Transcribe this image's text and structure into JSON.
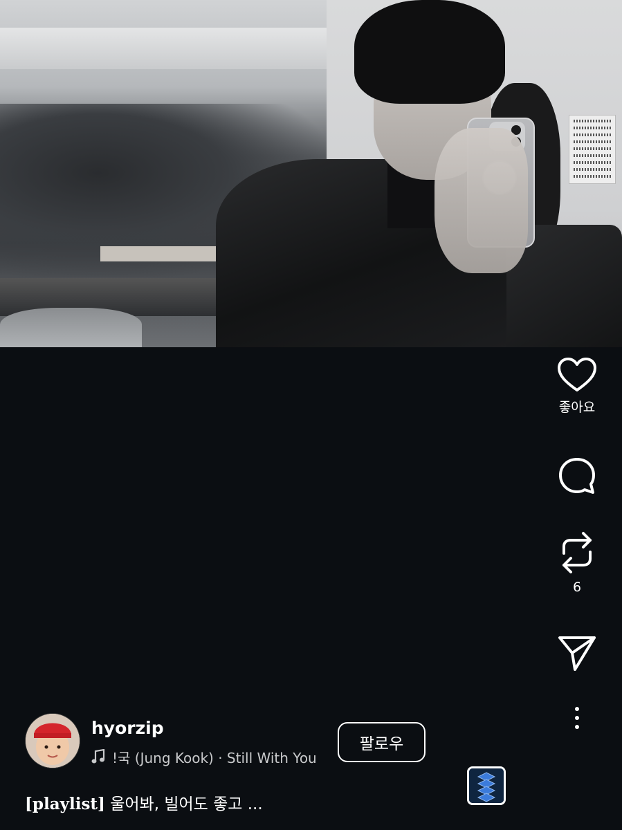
{
  "post": {
    "like_label": "좋아요",
    "repost_count": "6",
    "username": "hyorzip",
    "music": "!국 (Jung Kook) · Still With You",
    "follow_label": "팔로우",
    "caption_tag": "[playlist]",
    "caption_text": " 울어봐, 빌어도 좋고 ..."
  },
  "icons": {
    "like": "heart-icon",
    "comment": "comment-icon",
    "repost": "repost-icon",
    "share": "send-icon",
    "more": "more-vertical-icon",
    "music": "music-note-icon"
  },
  "colors": {
    "background": "#0b0e12",
    "text": "#ffffff",
    "secondary_text": "#c8c9cb",
    "album_accent": "#3b7bdb"
  }
}
